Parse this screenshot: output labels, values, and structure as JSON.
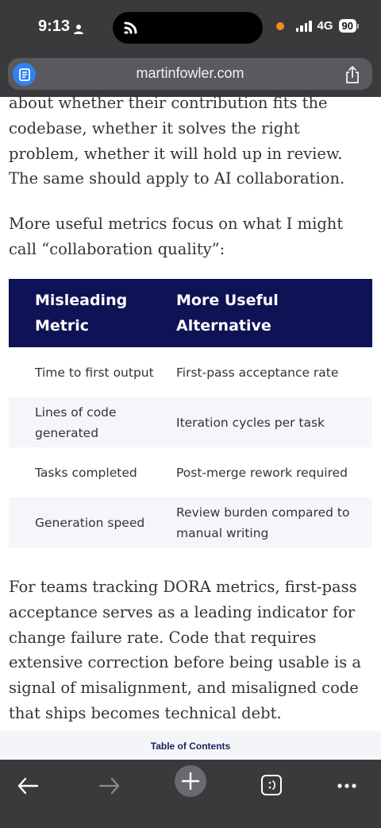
{
  "status_bar": {
    "time": "9:13",
    "network": "4G",
    "battery": "90"
  },
  "browser": {
    "url": "martinfowler.com"
  },
  "article": {
    "para1": "about whether their contribution fits the codebase, whether it solves the right problem, whether it will hold up in review. The same should apply to AI collaboration.",
    "para2": "More useful metrics focus on what I might call “collaboration quality”:",
    "table": {
      "headers": [
        "Misleading Metric",
        "More Useful Alternative"
      ],
      "rows": [
        [
          "Time to first output",
          "First-pass acceptance rate"
        ],
        [
          "Lines of code generated",
          "Iteration cycles per task"
        ],
        [
          "Tasks completed",
          "Post-merge rework required"
        ],
        [
          "Generation speed",
          "Review burden compared to manual writing"
        ]
      ]
    },
    "para3": "For teams tracking DORA metrics, first-pass acceptance serves as a leading indicator for change failure rate. Code that requires extensive correction before being usable is a signal of misalignment, and misaligned code that ships becomes technical debt."
  },
  "toc": {
    "label": "Table of Contents"
  },
  "colors": {
    "header_bg": "#0e1356",
    "chrome_bg": "#3a3a3c",
    "tab_icon": "#2f82f6",
    "recording_dot": "#f28a1c"
  },
  "icons": [
    "person-icon",
    "island-app-icon",
    "signal-icon",
    "battery-icon",
    "tabs-icon",
    "share-icon",
    "back-arrow-icon",
    "forward-arrow-icon",
    "plus-icon",
    "tab-switcher-icon",
    "more-icon"
  ]
}
